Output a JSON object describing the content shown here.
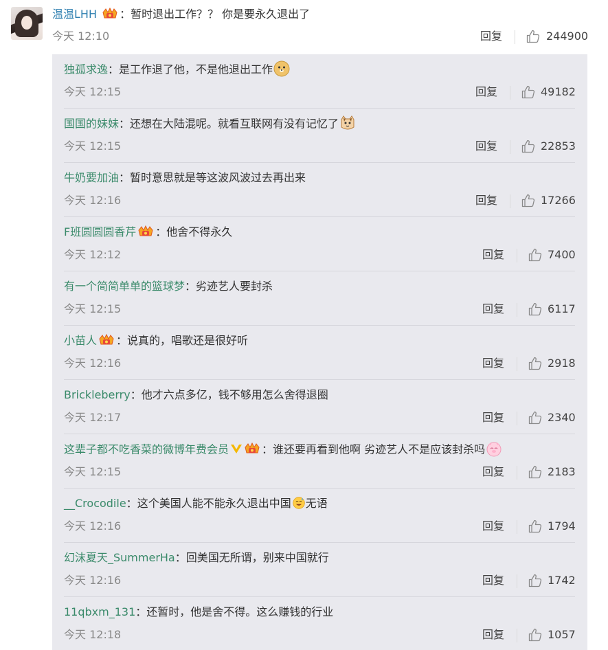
{
  "main_comment": {
    "username": "温温LHH",
    "text": "暂时退出工作？？ 你是要永久退出了",
    "time": "今天 12:10",
    "reply_label": "回复",
    "likes": "244900",
    "has_badge": true
  },
  "replies": [
    {
      "username": "独孤求逸",
      "text": "是工作退了他，不是他退出工作",
      "emoji": "doge",
      "time": "今天 12:15",
      "reply_label": "回复",
      "likes": "49182"
    },
    {
      "username": "国国的妹妹",
      "text": "还想在大陆混呢。就看互联网有没有记忆了",
      "emoji": "cat",
      "time": "今天 12:15",
      "reply_label": "回复",
      "likes": "22853"
    },
    {
      "username": "牛奶要加油",
      "text": "暂时意思就是等这波风波过去再出来",
      "time": "今天 12:16",
      "reply_label": "回复",
      "likes": "17266"
    },
    {
      "username": "F班圆圆圆香芹",
      "text": "他舍不得永久",
      "badge": true,
      "time": "今天 12:12",
      "reply_label": "回复",
      "likes": "7400"
    },
    {
      "username": "有一个简简单单的篮球梦",
      "text": "劣迹艺人要封杀",
      "time": "今天 12:15",
      "reply_label": "回复",
      "likes": "6117"
    },
    {
      "username": "小苗人",
      "text": "说真的，唱歌还是很好听",
      "badge": true,
      "time": "今天 12:16",
      "reply_label": "回复",
      "likes": "2918"
    },
    {
      "username": "Brickleberry",
      "text": "他才六点多亿，钱不够用怎么舍得退圈",
      "time": "今天 12:17",
      "reply_label": "回复",
      "likes": "2340"
    },
    {
      "username": "这辈子都不吃香菜的微博年费会员",
      "text": "谁还要再看到他啊 劣迹艺人不是应该封杀吗",
      "vip": true,
      "badge": true,
      "emoji": "pig",
      "time": "今天 12:15",
      "reply_label": "回复",
      "likes": "2183"
    },
    {
      "username": "__Crocodile",
      "text_before": "这个美国人能不能永久退出中国",
      "text_after": "无语",
      "inline_emoji": "sweat",
      "time": "今天 12:16",
      "reply_label": "回复",
      "likes": "1794"
    },
    {
      "username": "幻沫夏天_SummerHa",
      "text": "回美国无所谓，别来中国就行",
      "time": "今天 12:16",
      "reply_label": "回复",
      "likes": "1742"
    },
    {
      "username": "11qbxm_131",
      "text": "还暂时，他是舍不得。这么赚钱的行业",
      "time": "今天 12:18",
      "reply_label": "回复",
      "likes": "1057"
    }
  ],
  "colors": {
    "username": "#2e7fb0",
    "reply_bg": "#e9e9ee"
  },
  "icons": {
    "like": "thumbs-up-icon",
    "badge": "crown-badge-icon"
  },
  "colon": "："
}
